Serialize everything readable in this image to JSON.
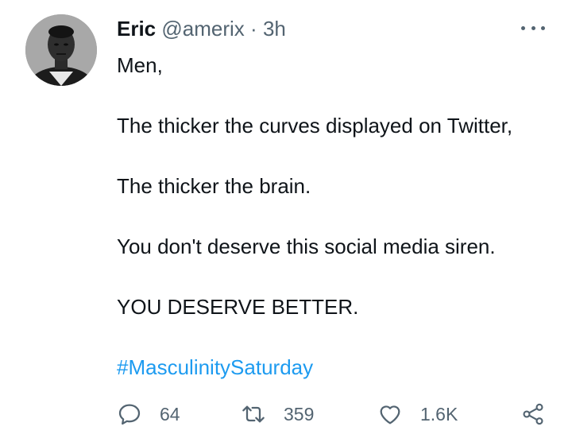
{
  "tweet": {
    "author_name": "Eric",
    "handle": "@amerix",
    "separator": "·",
    "time": "3h",
    "lines": [
      "Men,",
      "The thicker the curves displayed on Twitter,",
      "The thicker the brain.",
      "You don't deserve this social media siren.",
      "YOU DESERVE BETTER."
    ],
    "hashtag": "#MasculinitySaturday"
  },
  "actions": {
    "replies": "64",
    "retweets": "359",
    "likes": "1.6K"
  },
  "icons": {
    "more": "more-horizontal-icon",
    "reply": "reply-icon",
    "retweet": "retweet-icon",
    "like": "heart-icon",
    "share": "share-icon"
  },
  "colors": {
    "text": "#0f1419",
    "muted": "#536471",
    "link": "#1d9bf0"
  }
}
